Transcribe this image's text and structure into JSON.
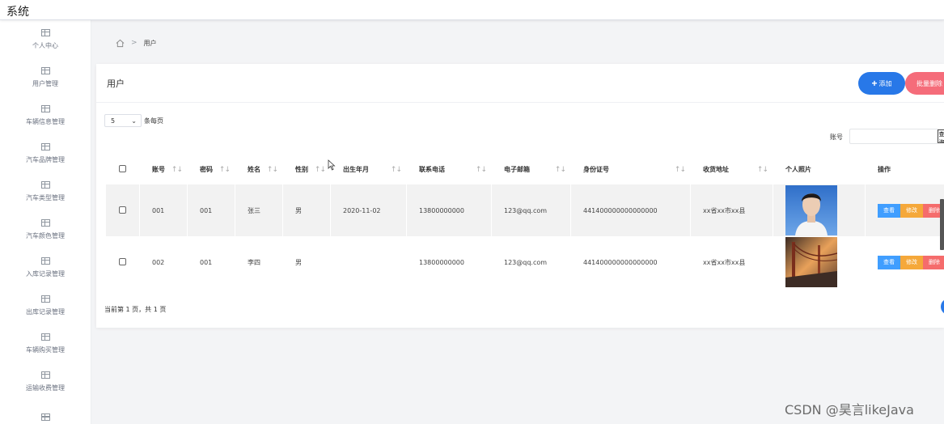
{
  "app": {
    "title": "系统"
  },
  "sidebar": {
    "items": [
      {
        "label": "个人中心",
        "icon": "table-icon"
      },
      {
        "label": "用户管理",
        "icon": "table-icon"
      },
      {
        "label": "车辆信息管理",
        "icon": "table-icon"
      },
      {
        "label": "汽车品牌管理",
        "icon": "table-icon"
      },
      {
        "label": "汽车类型管理",
        "icon": "table-icon"
      },
      {
        "label": "汽车颜色管理",
        "icon": "table-icon"
      },
      {
        "label": "入库记录管理",
        "icon": "table-icon"
      },
      {
        "label": "出库记录管理",
        "icon": "table-icon"
      },
      {
        "label": "车辆购买管理",
        "icon": "table-icon"
      },
      {
        "label": "运输收费管理",
        "icon": "table-icon"
      },
      {
        "label": "",
        "icon": "table-icon"
      }
    ]
  },
  "breadcrumb": {
    "separator": ">",
    "current": "用户"
  },
  "card": {
    "title": "用户",
    "add_label": "添加",
    "batch_delete_label": "批量删除"
  },
  "pagesize": {
    "selected": "5",
    "label": "条每页"
  },
  "search": {
    "label": "账号",
    "value": "",
    "button_label": "查询"
  },
  "table": {
    "columns": [
      "账号",
      "密码",
      "姓名",
      "性别",
      "出生年月",
      "联系电话",
      "电子邮箱",
      "身份证号",
      "收货地址",
      "个人照片",
      "操作"
    ],
    "rows": [
      {
        "account": "001",
        "password": "001",
        "name": "张三",
        "gender": "男",
        "birth": "2020-11-02",
        "phone": "13800000000",
        "email": "123@qq.com",
        "id_number": "441400000000000000",
        "address": "xx省xx市xx县",
        "photo": "portrait-photo"
      },
      {
        "account": "002",
        "password": "001",
        "name": "李四",
        "gender": "男",
        "birth": "",
        "phone": "13800000000",
        "email": "123@qq.com",
        "id_number": "441400000000000000",
        "address": "xx省xx市xx县",
        "photo": "bridge-photo"
      }
    ],
    "actions": {
      "view": "查看",
      "edit": "修改",
      "delete": "删除"
    }
  },
  "pager": {
    "text": "当前第 1 页，共 1 页"
  },
  "watermark": "CSDN @昊言likeJava",
  "colors": {
    "primary": "#2878e8",
    "danger": "#f56c7a",
    "view": "#409eff",
    "edit": "#f5a83a",
    "delete": "#f56c6c"
  }
}
